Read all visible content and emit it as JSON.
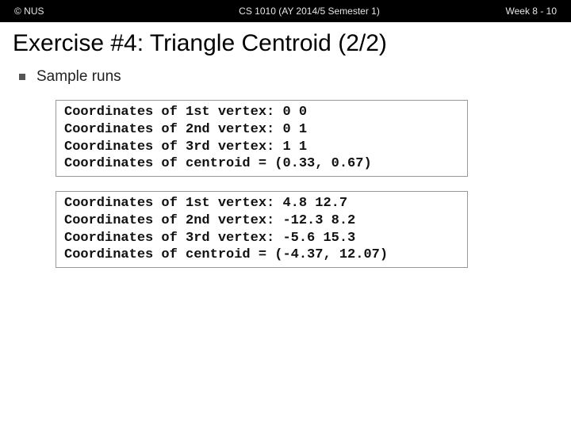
{
  "header": {
    "left": "© NUS",
    "center": "CS 1010 (AY 2014/5 Semester 1)",
    "right": "Week 8 - 10"
  },
  "title": "Exercise #4: Triangle Centroid (2/2)",
  "bullet": "Sample runs",
  "code1": "Coordinates of 1st vertex: 0 0\nCoordinates of 2nd vertex: 0 1\nCoordinates of 3rd vertex: 1 1\nCoordinates of centroid = (0.33, 0.67)",
  "code2": "Coordinates of 1st vertex: 4.8 12.7\nCoordinates of 2nd vertex: -12.3 8.2\nCoordinates of 3rd vertex: -5.6 15.3\nCoordinates of centroid = (-4.37, 12.07)"
}
